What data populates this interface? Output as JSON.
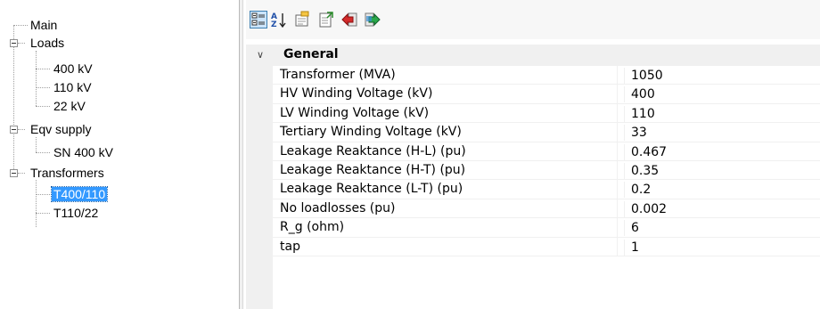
{
  "tree": {
    "main": "Main",
    "loads": {
      "label": "Loads",
      "children": [
        "400 kV",
        "110 kV",
        "22 kV"
      ]
    },
    "eqv_supply": {
      "label": "Eqv supply",
      "children": [
        "SN 400 kV"
      ]
    },
    "transformers": {
      "label": "Transformers",
      "children": [
        "T400/110",
        "T110/22"
      ]
    },
    "selected": "T400/110"
  },
  "toolbar": {
    "buttons": [
      "categorized-icon",
      "alphabetical-icon",
      "property-pages-icon",
      "export-icon",
      "back-icon",
      "forward-icon"
    ]
  },
  "grid": {
    "category": "General",
    "properties": [
      {
        "name": "Transformer (MVA)",
        "value": "1050"
      },
      {
        "name": "HV Winding Voltage (kV)",
        "value": "400"
      },
      {
        "name": "LV Winding Voltage (kV)",
        "value": "110"
      },
      {
        "name": "Tertiary Winding Voltage (kV)",
        "value": "33"
      },
      {
        "name": "Leakage Reaktance (H-L) (pu)",
        "value": "0.467"
      },
      {
        "name": "Leakage Reaktance (H-T) (pu)",
        "value": "0.35"
      },
      {
        "name": "Leakage Reaktance (L-T) (pu)",
        "value": "0.2"
      },
      {
        "name": "No loadlosses (pu)",
        "value": "0.002"
      },
      {
        "name": "R_g (ohm)",
        "value": "6"
      },
      {
        "name": "tap",
        "value": "1"
      }
    ]
  },
  "colors": {
    "selection": "#3399ff",
    "toolbar_active": "#cbe4fa",
    "grid_line": "#f0f0f0"
  }
}
